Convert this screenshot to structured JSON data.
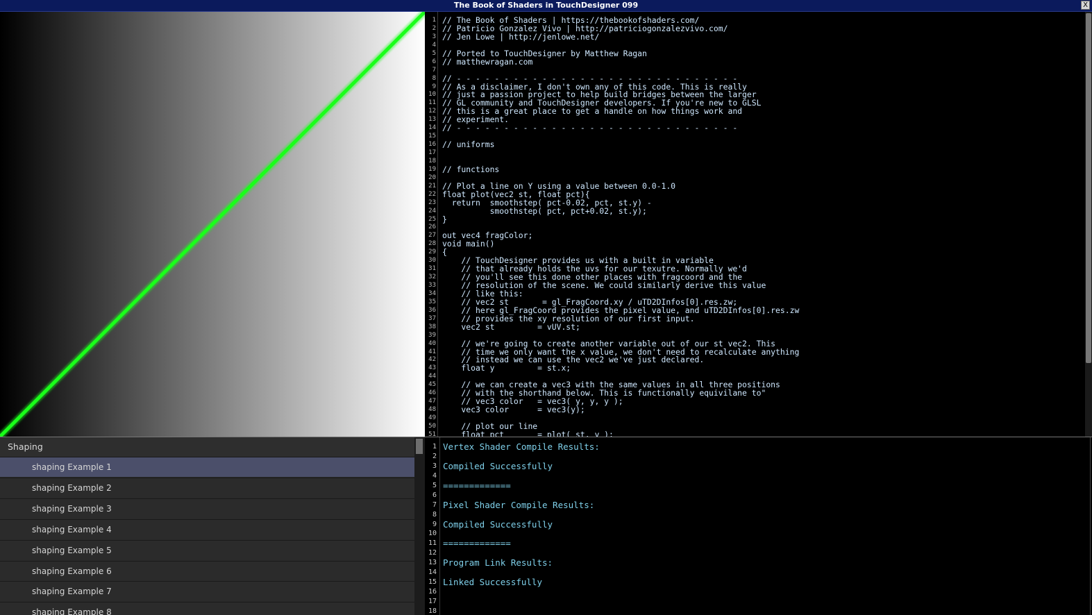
{
  "window": {
    "title": "The Book of Shaders in TouchDesigner 099",
    "close_label": "X"
  },
  "preview": {
    "line_color": "#1aff1a"
  },
  "code_editor": {
    "lines": [
      {
        "n": "1",
        "t": "// The Book of Shaders | https://thebookofshaders.com/"
      },
      {
        "n": "2",
        "t": "// Patricio Gonzalez Vivo | http://patriciogonzalezvivo.com/"
      },
      {
        "n": "3",
        "t": "// Jen Lowe | http://jenlowe.net/"
      },
      {
        "n": "4",
        "t": ""
      },
      {
        "n": "5",
        "t": "// Ported to TouchDesigner by Matthew Ragan"
      },
      {
        "n": "6",
        "t": "// matthewragan.com"
      },
      {
        "n": "7",
        "t": ""
      },
      {
        "n": "8",
        "t": "// - - - - - - - - - - - - - - - - - - - - - - - - - - - - - -"
      },
      {
        "n": "9",
        "t": "// As a disclaimer, I don't own any of this code. This is really"
      },
      {
        "n": "10",
        "t": "// just a passion project to help build bridges between the larger"
      },
      {
        "n": "11",
        "t": "// GL community and TouchDesigner developers. If you're new to GLSL"
      },
      {
        "n": "12",
        "t": "// this is a great place to get a handle on how things work and"
      },
      {
        "n": "13",
        "t": "// experiment."
      },
      {
        "n": "14",
        "t": "// - - - - - - - - - - - - - - - - - - - - - - - - - - - - - -"
      },
      {
        "n": "15",
        "t": ""
      },
      {
        "n": "16",
        "t": "// uniforms"
      },
      {
        "n": "17",
        "t": ""
      },
      {
        "n": "18",
        "t": ""
      },
      {
        "n": "19",
        "t": "// functions"
      },
      {
        "n": "20",
        "t": ""
      },
      {
        "n": "21",
        "t": "// Plot a line on Y using a value between 0.0-1.0"
      },
      {
        "n": "22",
        "t": "float plot(vec2 st, float pct){"
      },
      {
        "n": "23",
        "t": "  return  smoothstep( pct-0.02, pct, st.y) -"
      },
      {
        "n": "24",
        "t": "          smoothstep( pct, pct+0.02, st.y);"
      },
      {
        "n": "25",
        "t": "}"
      },
      {
        "n": "26",
        "t": ""
      },
      {
        "n": "27",
        "t": "out vec4 fragColor;"
      },
      {
        "n": "28",
        "t": "void main()"
      },
      {
        "n": "29",
        "t": "{"
      },
      {
        "n": "30",
        "t": "    // TouchDesigner provides us with a built in variable"
      },
      {
        "n": "31",
        "t": "    // that already holds the uvs for our texutre. Normally we'd"
      },
      {
        "n": "32",
        "t": "    // you'll see this done other places with fragcoord and the"
      },
      {
        "n": "33",
        "t": "    // resolution of the scene. We could similarly derive this value"
      },
      {
        "n": "34",
        "t": "    // like this:"
      },
      {
        "n": "35",
        "t": "    // vec2 st       = gl_FragCoord.xy / uTD2DInfos[0].res.zw;"
      },
      {
        "n": "36",
        "t": "    // here gl_FragCoord provides the pixel value, and uTD2DInfos[0].res.zw"
      },
      {
        "n": "37",
        "t": "    // provides the xy resolution of our first input."
      },
      {
        "n": "38",
        "t": "    vec2 st         = vUV.st;"
      },
      {
        "n": "39",
        "t": ""
      },
      {
        "n": "40",
        "t": "    // we're going to create another variable out of our st vec2. This"
      },
      {
        "n": "41",
        "t": "    // time we only want the x value, we don't need to recalculate anything"
      },
      {
        "n": "42",
        "t": "    // instead we can use the vec2 we've just declared."
      },
      {
        "n": "43",
        "t": "    float y         = st.x;"
      },
      {
        "n": "44",
        "t": ""
      },
      {
        "n": "45",
        "t": "    // we can create a vec3 with the same values in all three positions"
      },
      {
        "n": "46",
        "t": "    // with the shorthand below. This is functionally equivilane to\""
      },
      {
        "n": "47",
        "t": "    // vec3 color   = vec3( y, y, y );"
      },
      {
        "n": "48",
        "t": "    vec3 color      = vec3(y);"
      },
      {
        "n": "49",
        "t": ""
      },
      {
        "n": "50",
        "t": "    // plot our line"
      },
      {
        "n": "51",
        "t": "    float pct       = plot( st, y );"
      }
    ]
  },
  "example_list": {
    "header": "Shaping",
    "items": [
      "shaping Example 1",
      "shaping Example 2",
      "shaping Example 3",
      "shaping Example 4",
      "shaping Example 5",
      "shaping Example 6",
      "shaping Example 7",
      "shaping Example 8"
    ],
    "selected_index": 0
  },
  "compile_output": {
    "lines": [
      {
        "n": "1",
        "t": "Vertex Shader Compile Results:"
      },
      {
        "n": "2",
        "t": ""
      },
      {
        "n": "3",
        "t": "Compiled Successfully"
      },
      {
        "n": "4",
        "t": ""
      },
      {
        "n": "5",
        "t": "============="
      },
      {
        "n": "6",
        "t": ""
      },
      {
        "n": "7",
        "t": "Pixel Shader Compile Results:"
      },
      {
        "n": "8",
        "t": ""
      },
      {
        "n": "9",
        "t": "Compiled Successfully"
      },
      {
        "n": "10",
        "t": ""
      },
      {
        "n": "11",
        "t": "============="
      },
      {
        "n": "12",
        "t": ""
      },
      {
        "n": "13",
        "t": "Program Link Results:"
      },
      {
        "n": "14",
        "t": ""
      },
      {
        "n": "15",
        "t": "Linked Successfully"
      },
      {
        "n": "16",
        "t": ""
      },
      {
        "n": "17",
        "t": ""
      },
      {
        "n": "18",
        "t": ""
      }
    ]
  }
}
